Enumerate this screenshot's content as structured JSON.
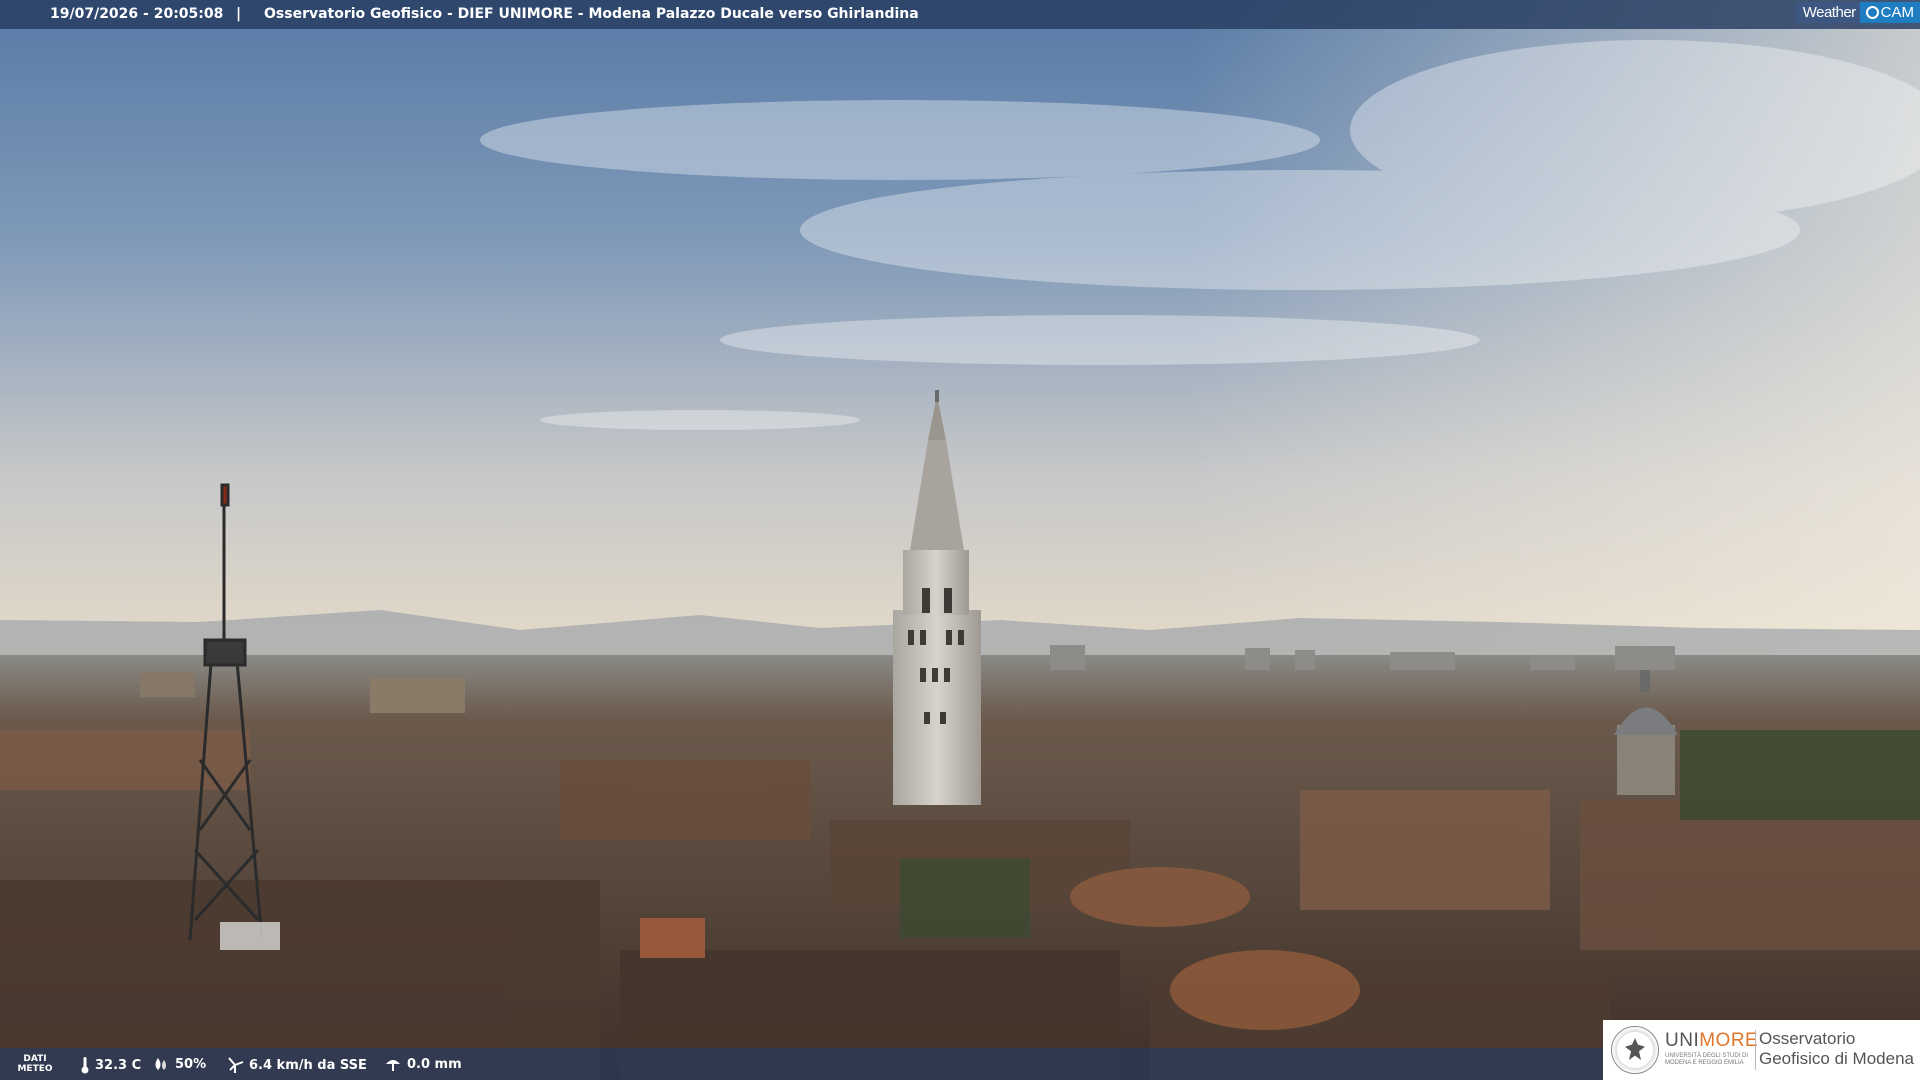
{
  "overlay": {
    "timestamp": "19/07/2026 - 20:05:08",
    "separator": "|",
    "title": "Osservatorio Geofisico - DIEF UNIMORE - Modena Palazzo Ducale verso Ghirlandina"
  },
  "brand": {
    "left": "Weather",
    "right": "CAM"
  },
  "weather": {
    "label": "DATI METEO",
    "temperature": "32.3 C",
    "humidity": "50%",
    "wind": "6.4 km/h da SSE",
    "rain": "0.0 mm"
  },
  "logo": {
    "uni_prefix": "UNI",
    "uni_suffix": "MORE",
    "uni_sub": "UNIVERSITÀ DEGLI STUDI DI MODENA E REGGIO EMILIA",
    "observatory": "Osservatorio Geofisico di Modena"
  },
  "colors": {
    "sky_top": "#5c7aa2",
    "sky_horizon": "#e6dccb",
    "roofs": "#6e5444",
    "overlay_bar": "#263c60",
    "brand_blue": "#1f7dc2",
    "logo_orange": "#e0762a"
  },
  "icons": [
    "thermometer-icon",
    "humidity-icon",
    "wind-icon",
    "rain-gauge-icon",
    "university-seal-icon"
  ]
}
